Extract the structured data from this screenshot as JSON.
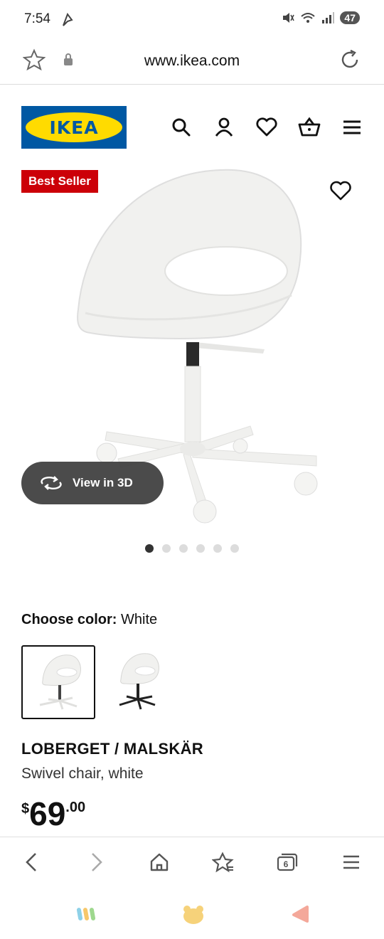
{
  "status": {
    "time": "7:54",
    "battery": "47"
  },
  "browser": {
    "url": "www.ikea.com",
    "tab_count": "6"
  },
  "header": {
    "logo_text": "IKEA",
    "icons": [
      "search-icon",
      "account-icon",
      "heart-icon",
      "basket-icon",
      "menu-icon"
    ]
  },
  "product": {
    "badge": "Best Seller",
    "view3d_label": "View in 3D",
    "gallery_dots": 6,
    "gallery_active_index": 0,
    "color_label": "Choose color:",
    "color_value": "White",
    "swatches": [
      "White base",
      "Black base"
    ],
    "name": "LOBERGET / MALSKÄR",
    "description": "Swivel chair, white",
    "price": {
      "currency": "$",
      "integer": "69",
      "decimals": ".00"
    }
  },
  "colors": {
    "ikea_blue": "#0058a3",
    "ikea_yellow": "#ffdb00",
    "badge_red": "#cc0008"
  }
}
